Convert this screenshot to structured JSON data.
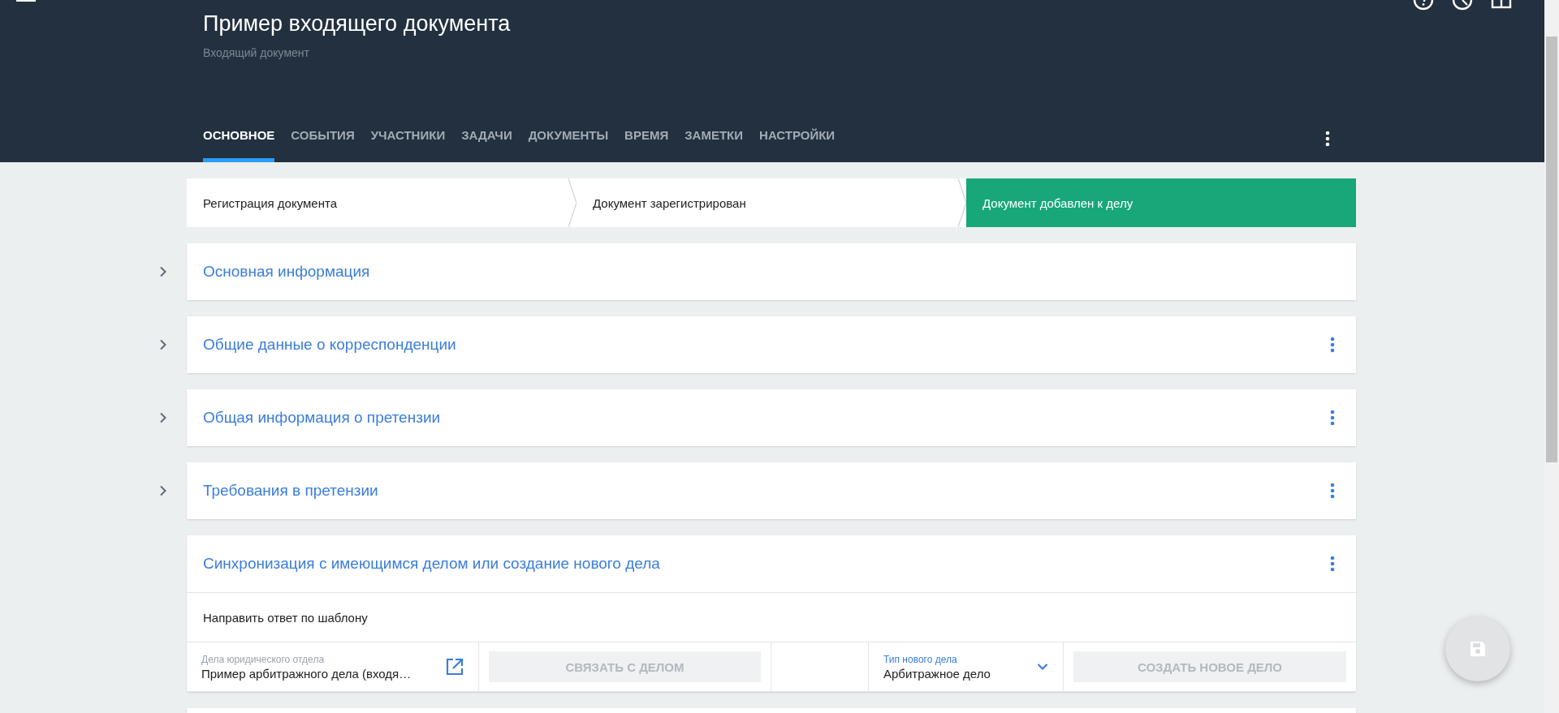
{
  "header": {
    "title": "Пример входящего документа",
    "subtitle": "Входящий документ"
  },
  "tabs": [
    {
      "label": "ОСНОВНОЕ",
      "selected": true
    },
    {
      "label": "СОБЫТИЯ",
      "selected": false
    },
    {
      "label": "УЧАСТНИКИ",
      "selected": false
    },
    {
      "label": "ЗАДАЧИ",
      "selected": false
    },
    {
      "label": "ДОКУМЕНТЫ",
      "selected": false
    },
    {
      "label": "ВРЕМЯ",
      "selected": false
    },
    {
      "label": "ЗАМЕТКИ",
      "selected": false
    },
    {
      "label": "НАСТРОЙКИ",
      "selected": false
    }
  ],
  "steps": [
    {
      "label": "Регистрация документа",
      "selected": false
    },
    {
      "label": "Документ зарегистрирован",
      "selected": false
    },
    {
      "label": "Документ добавлен к делу",
      "selected": true
    }
  ],
  "sections": [
    {
      "title": "Основная информация",
      "expanded": false,
      "menu": false
    },
    {
      "title": "Общие данные о корреспонденции",
      "expanded": false,
      "menu": true
    },
    {
      "title": "Общая информация о претензии",
      "expanded": false,
      "menu": true
    },
    {
      "title": "Требования в претензии",
      "expanded": false,
      "menu": true
    },
    {
      "title": "Синхронизация с имеющимся делом или создание нового дела",
      "expanded": true,
      "menu": true,
      "note": "Направить ответ по шаблону",
      "cells": [
        {
          "kind": "link-field",
          "label": "Дела юридического отдела",
          "value": "Пример арбитражного дела (входя…"
        },
        {
          "kind": "button",
          "label": "СВЯЗАТЬ С ДЕЛОМ",
          "disabled": true
        },
        {
          "kind": "empty"
        },
        {
          "kind": "select",
          "label": "Тип нового дела",
          "value": "Арбитражное дело"
        },
        {
          "kind": "button",
          "label": "СОЗДАТЬ НОВОЕ ДЕЛО",
          "disabled": true
        }
      ]
    }
  ]
}
